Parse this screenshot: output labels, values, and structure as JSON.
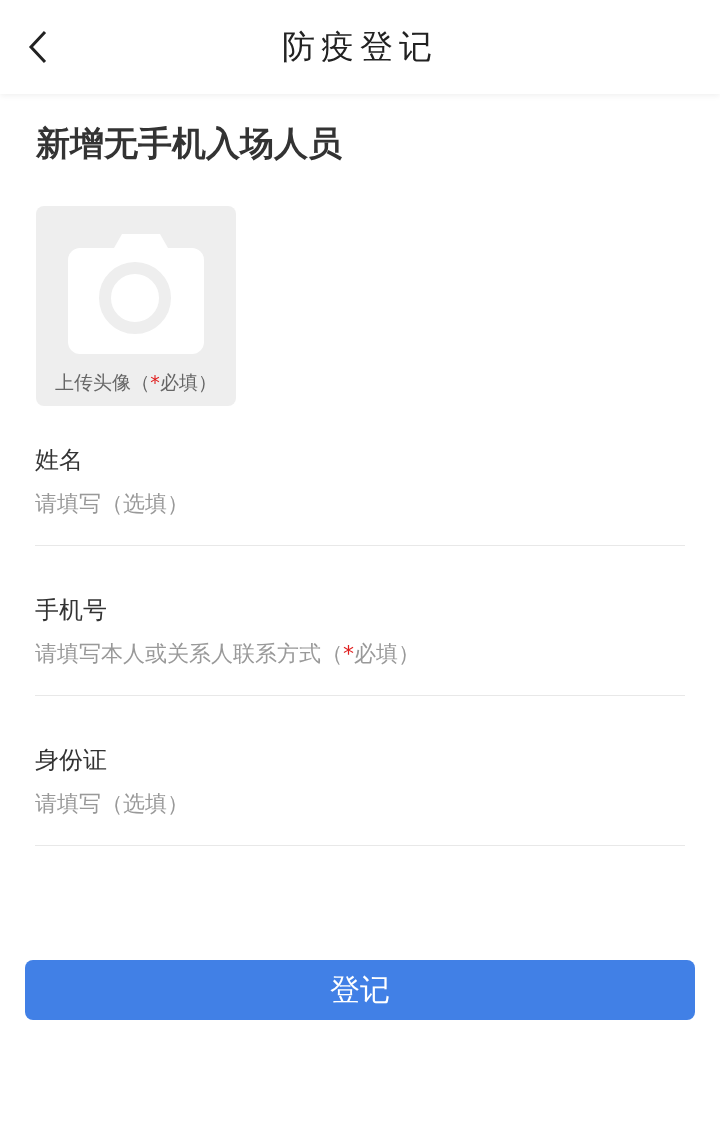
{
  "header": {
    "title": "防疫登记"
  },
  "page_title": "新增无手机入场人员",
  "avatar_upload": {
    "label": "上传头像（*必填）"
  },
  "fields": [
    {
      "label": "姓名",
      "placeholder": "请填写（选填）"
    },
    {
      "label": "手机号",
      "placeholder": "请填写本人或关系人联系方式（*必填）"
    },
    {
      "label": "身份证",
      "placeholder": "请填写（选填）"
    }
  ],
  "submit_button": "登记"
}
